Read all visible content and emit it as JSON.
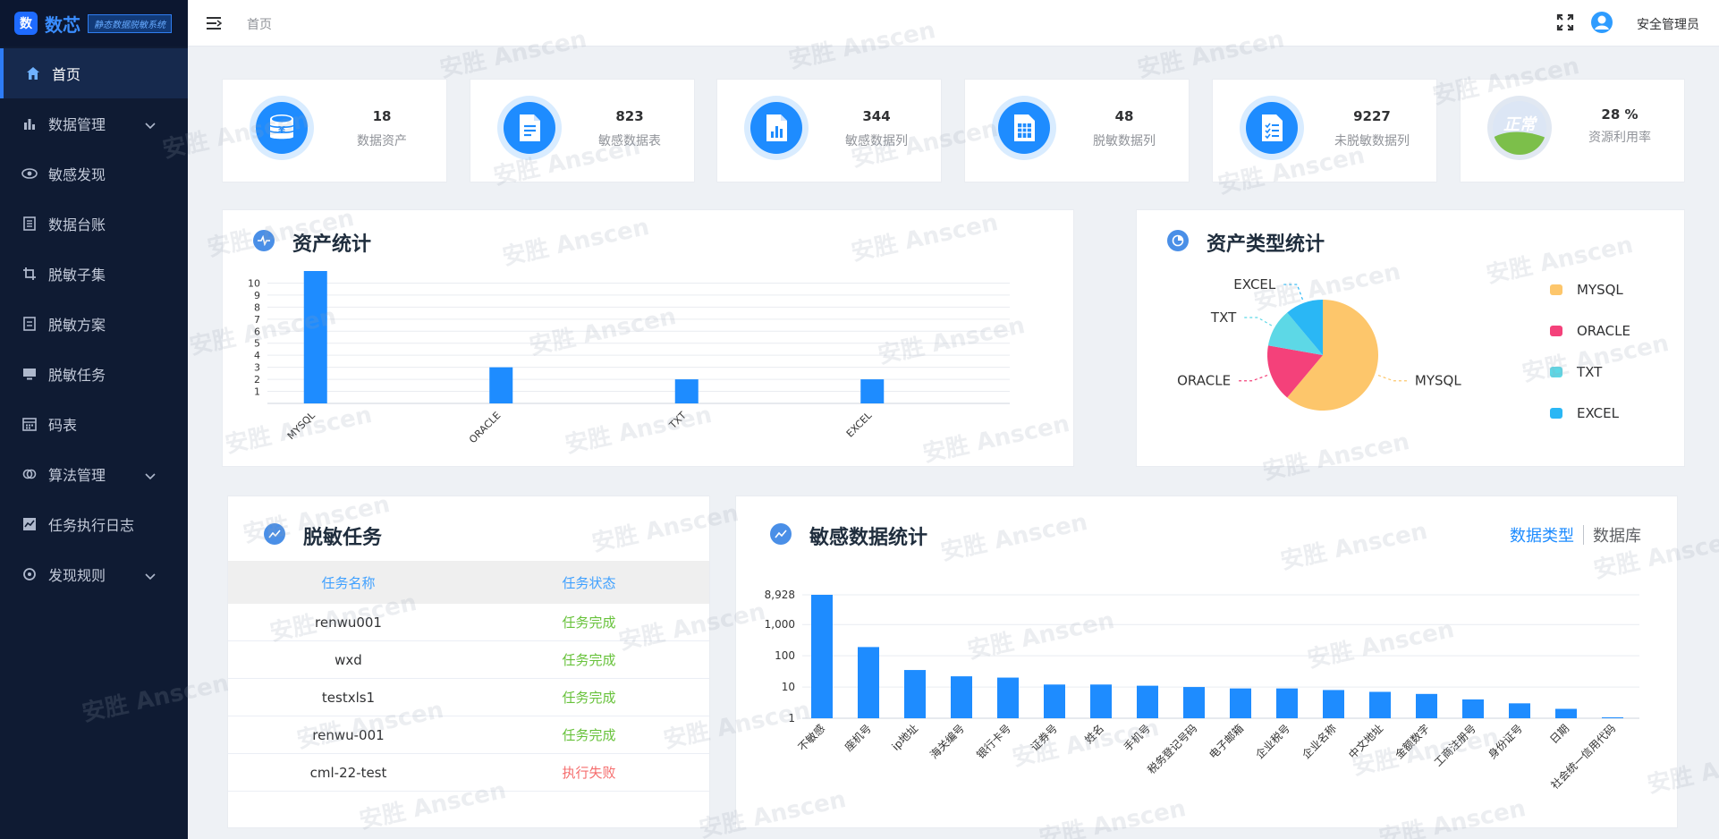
{
  "app": {
    "logo_mark": "数",
    "name": "数芯",
    "subtitle": "静态数据脱敏系统"
  },
  "sidebar": {
    "items": [
      {
        "label": "首页",
        "icon": "home-icon",
        "active": true
      },
      {
        "label": "数据管理",
        "icon": "bar-chart-icon",
        "chevron": true
      },
      {
        "label": "敏感发现",
        "icon": "eye-icon"
      },
      {
        "label": "数据台账",
        "icon": "ledger-icon"
      },
      {
        "label": "脱敏子集",
        "icon": "crop-icon"
      },
      {
        "label": "脱敏方案",
        "icon": "document-icon"
      },
      {
        "label": "脱敏任务",
        "icon": "monitor-icon"
      },
      {
        "label": "码表",
        "icon": "calendar-icon"
      },
      {
        "label": "算法管理",
        "icon": "algorithm-icon",
        "chevron": true
      },
      {
        "label": "任务执行日志",
        "icon": "chart-log-icon"
      },
      {
        "label": "发现规则",
        "icon": "rule-icon",
        "chevron": true
      }
    ]
  },
  "header": {
    "breadcrumb": "首页",
    "user": "安全管理员"
  },
  "stats": [
    {
      "value": "18",
      "label": "数据资产",
      "icon": "database-coin-icon"
    },
    {
      "value": "823",
      "label": "敏感数据表",
      "icon": "document-list-icon"
    },
    {
      "value": "344",
      "label": "敏感数据列",
      "icon": "document-chart-icon"
    },
    {
      "value": "48",
      "label": "脱敏数据列",
      "icon": "spreadsheet-icon"
    },
    {
      "value": "9227",
      "label": "未脱敏数据列",
      "icon": "checklist-icon"
    },
    {
      "value": "28 %",
      "label": "资源利用率",
      "icon": "status-normal-icon",
      "badge": "正常"
    }
  ],
  "asset_stats": {
    "title": "资产统计"
  },
  "asset_type": {
    "title": "资产类型统计"
  },
  "task_panel": {
    "title": "脱敏任务",
    "columns": [
      "任务名称",
      "任务状态"
    ],
    "rows": [
      {
        "name": "renwu001",
        "status": "任务完成",
        "ok": true
      },
      {
        "name": "wxd",
        "status": "任务完成",
        "ok": true
      },
      {
        "name": "testxls1",
        "status": "任务完成",
        "ok": true
      },
      {
        "name": "renwu-001",
        "status": "任务完成",
        "ok": true
      },
      {
        "name": "cml-22-test",
        "status": "执行失败",
        "ok": false
      }
    ]
  },
  "sensitive_panel": {
    "title": "敏感数据统计",
    "tabs": [
      "数据类型",
      "数据库"
    ]
  },
  "watermark": "安胜 Anscen",
  "colors": {
    "accent": "#1e8cff",
    "sidebar_bg": "#0f1b33",
    "ok": "#67c23a",
    "fail": "#f56c6c"
  },
  "chart_data": [
    {
      "type": "bar",
      "categories": [
        "MYSQL",
        "ORACLE",
        "TXT",
        "EXCEL"
      ],
      "values": [
        11,
        3,
        2,
        2
      ],
      "ylim": [
        0,
        11
      ],
      "yticks": [
        1,
        2,
        3,
        4,
        5,
        6,
        7,
        8,
        9,
        10
      ],
      "grid": true,
      "color": "#1e8cff"
    },
    {
      "type": "pie",
      "categories": [
        "MYSQL",
        "ORACLE",
        "TXT",
        "EXCEL"
      ],
      "values": [
        11,
        3,
        2,
        2
      ],
      "colors": [
        "#fdc66b",
        "#f4417a",
        "#5dd8e6",
        "#2ab7f5"
      ],
      "legend": "right"
    },
    {
      "type": "bar",
      "yscale": "log",
      "categories": [
        "不敏感",
        "座机号",
        "ip地址",
        "海关编号",
        "银行卡号",
        "证券号",
        "姓名",
        "手机号",
        "税务登记号码",
        "电子邮箱",
        "企业税号",
        "企业名称",
        "中文地址",
        "金额数字",
        "工商注册号",
        "身份证号",
        "日期",
        "社会统一信用代码"
      ],
      "values": [
        8928,
        190,
        35,
        22,
        20,
        12,
        12,
        11,
        10,
        9,
        9,
        8,
        7,
        6,
        4,
        3,
        2,
        1
      ],
      "yticks": [
        1,
        10,
        100,
        1000,
        8928
      ],
      "yticklabels": [
        "1",
        "10",
        "100",
        "1,000",
        "8,928"
      ],
      "grid": true,
      "color": "#1e8cff"
    }
  ]
}
